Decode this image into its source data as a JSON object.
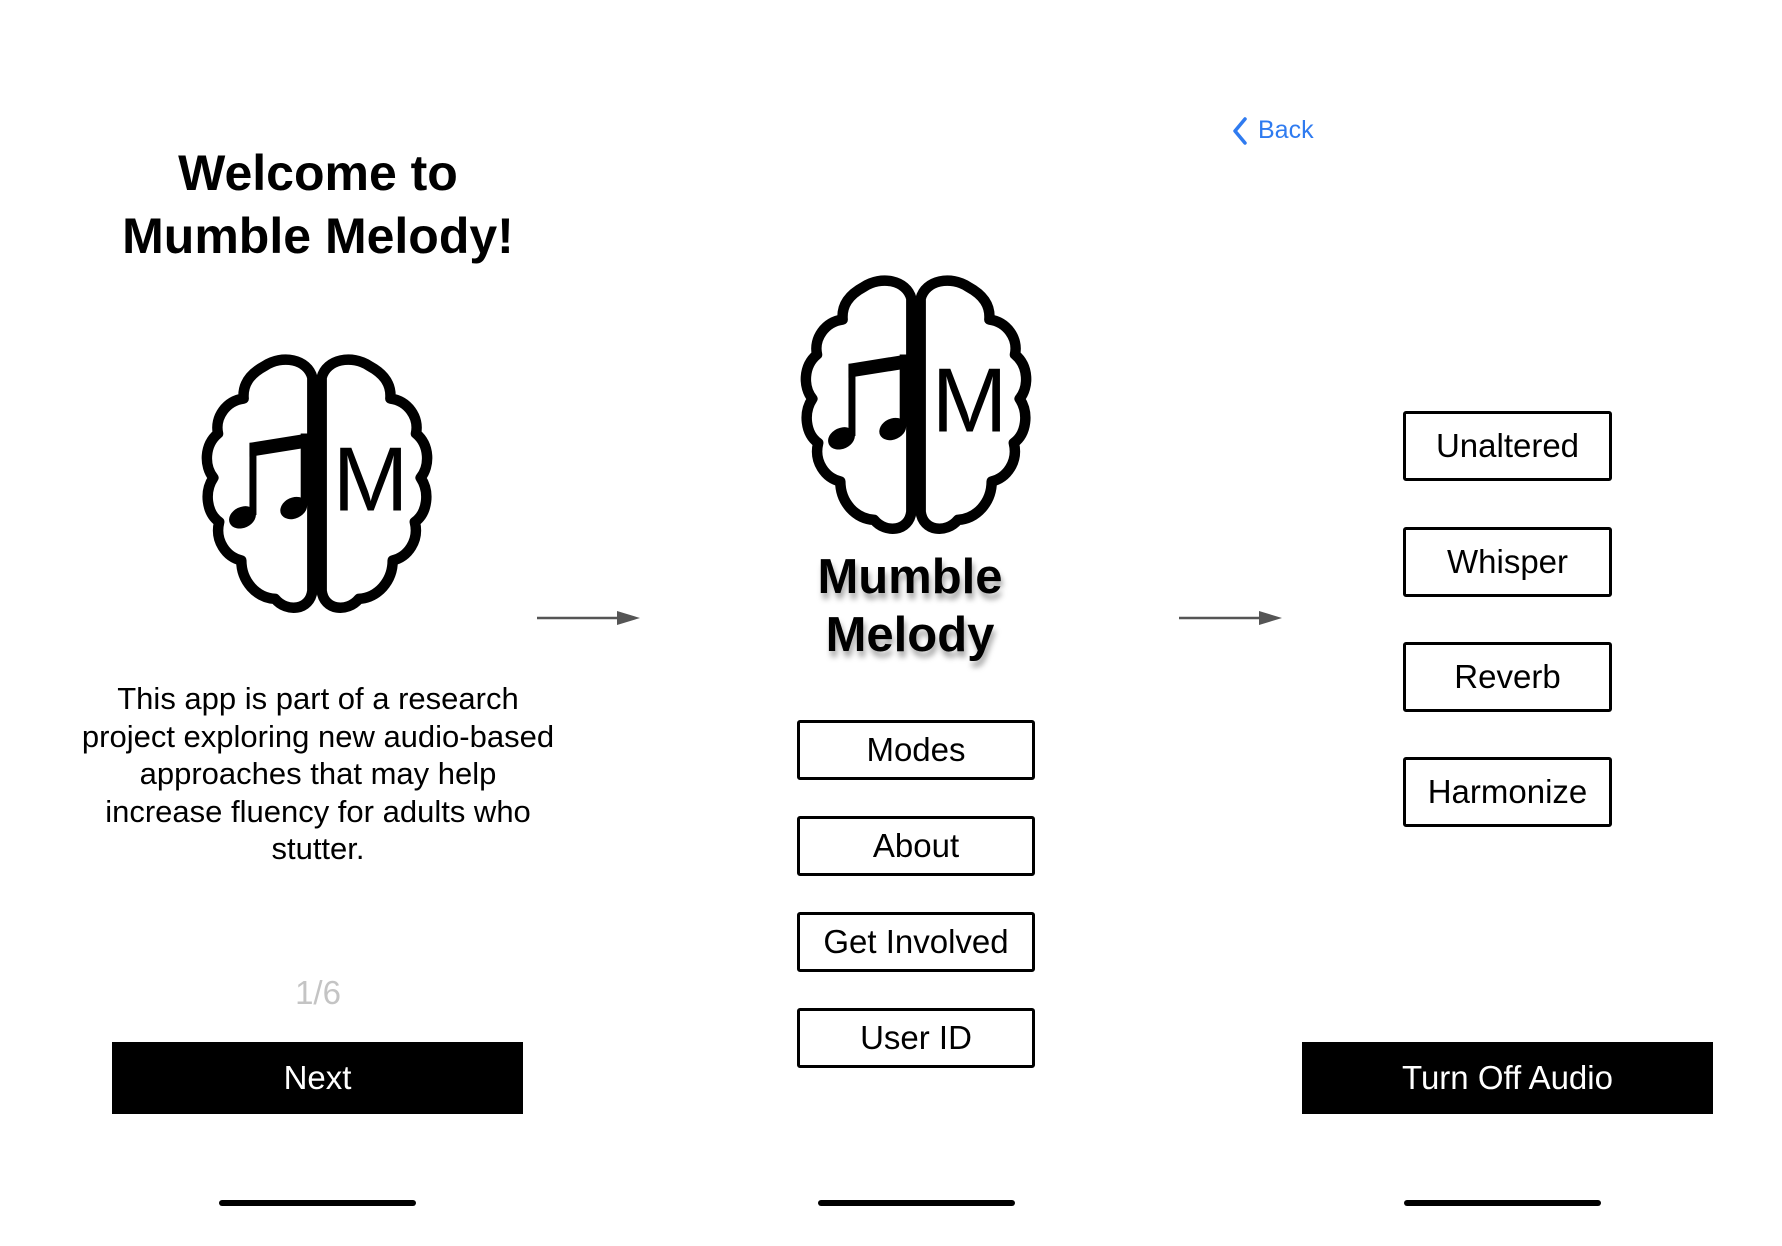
{
  "screen1": {
    "title_line1": "Welcome to",
    "title_line2": "Mumble Melody!",
    "description": "This app is part of a research project exploring new audio-based approaches that may help increase fluency for adults who stutter.",
    "pager": "1/6",
    "next_label": "Next",
    "logo_letter": "M"
  },
  "screen2": {
    "app_name_line1": "Mumble",
    "app_name_line2": "Melody",
    "logo_letter": "M",
    "menu": [
      {
        "label": "Modes"
      },
      {
        "label": "About"
      },
      {
        "label": "Get Involved"
      },
      {
        "label": "User ID"
      }
    ]
  },
  "screen3": {
    "back_label": "Back",
    "modes": [
      {
        "label": "Unaltered"
      },
      {
        "label": "Whisper"
      },
      {
        "label": "Reverb"
      },
      {
        "label": "Harmonize"
      }
    ],
    "turn_off_label": "Turn Off Audio"
  },
  "colors": {
    "accent": "#2f7bf0",
    "arrow": "#555555",
    "pager": "#c4c4c4"
  }
}
